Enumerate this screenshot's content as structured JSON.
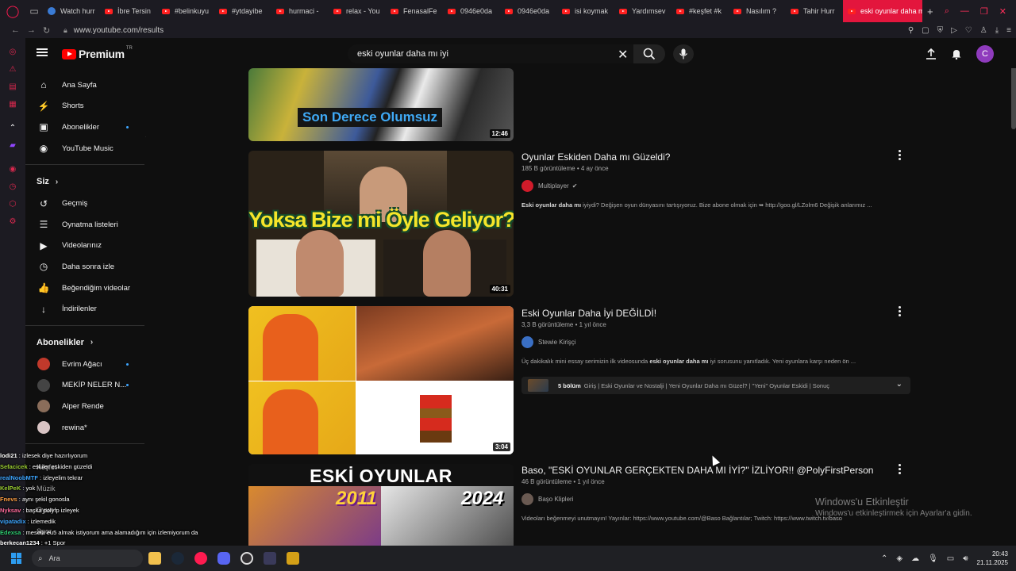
{
  "browser": {
    "tabs": [
      {
        "label": "Watch hurr",
        "kind": "blue"
      },
      {
        "label": "İbre Tersin",
        "kind": "yt"
      },
      {
        "label": "#belinkuyu",
        "kind": "yt"
      },
      {
        "label": "#ytdayibe",
        "kind": "yt"
      },
      {
        "label": "hurmaci -",
        "kind": "yt"
      },
      {
        "label": "relax - You",
        "kind": "yt"
      },
      {
        "label": "FenasalFe",
        "kind": "yt"
      },
      {
        "label": "0946e0da",
        "kind": "yt"
      },
      {
        "label": "0946e0da",
        "kind": "yt"
      },
      {
        "label": "isi koymak",
        "kind": "yt"
      },
      {
        "label": "Yardımsev",
        "kind": "yt"
      },
      {
        "label": "#keşfet #k",
        "kind": "yt"
      },
      {
        "label": "Nasılım ?",
        "kind": "yt"
      },
      {
        "label": "Tahir Hurr",
        "kind": "yt"
      }
    ],
    "active_tab": "eski oyunlar daha mı",
    "url": "www.youtube.com/results"
  },
  "masthead": {
    "logo": "Premium",
    "logo_country": "TR",
    "search_value": "eski oyunlar daha mı iyi",
    "avatar_letter": "C"
  },
  "guide": {
    "main": [
      {
        "label": "Ana Sayfa",
        "icon": "home-icon",
        "glyph": "⌂"
      },
      {
        "label": "Shorts",
        "icon": "shorts-icon",
        "glyph": "⚡"
      },
      {
        "label": "Abonelikler",
        "icon": "subscriptions-icon",
        "glyph": "▣",
        "dot": true
      },
      {
        "label": "YouTube Music",
        "icon": "music-icon",
        "glyph": "◉"
      }
    ],
    "you_heading": "Siz",
    "you": [
      {
        "label": "Geçmiş",
        "icon": "history-icon",
        "glyph": "↺"
      },
      {
        "label": "Oynatma listeleri",
        "icon": "playlists-icon",
        "glyph": "☰"
      },
      {
        "label": "Videolarınız",
        "icon": "your-videos-icon",
        "glyph": "▶"
      },
      {
        "label": "Daha sonra izle",
        "icon": "watch-later-icon",
        "glyph": "◷"
      },
      {
        "label": "Beğendiğim videolar",
        "icon": "liked-icon",
        "glyph": "👍"
      },
      {
        "label": "İndirilenler",
        "icon": "downloads-icon",
        "glyph": "↓"
      }
    ],
    "subs_heading": "Abonelikler",
    "subs": [
      {
        "label": "Evrim Ağacı",
        "color": "#c0392b",
        "dot": true
      },
      {
        "label": "MEKİP NELER N...",
        "color": "#444444",
        "dot": true
      },
      {
        "label": "Alper Rende",
        "color": "#8a6d5a",
        "dot": false
      },
      {
        "label": "rewina*",
        "color": "#d9c4c4",
        "dot": false
      }
    ]
  },
  "results": [
    {
      "duration": "12:46",
      "thumb_text": "Son Derece Olumsuz"
    },
    {
      "title": "Oyunlar Eskiden Daha mı Güzeldi?",
      "views": "185 B görüntüleme",
      "age": "4 ay önce",
      "channel": "Multiplayer",
      "verified": true,
      "desc_pre": "",
      "desc_bold": "Eski oyunlar daha mı",
      "desc_post": " iyiydi? Değişen oyun dünyasını tartışıyoruz. Bize abone olmak için ➥ http://goo.gl/LZolm6 Değişik anlarımız ...",
      "duration": "40:31",
      "thumb_text": "Yoksa Bize mi Öyle Geliyor?"
    },
    {
      "title": "Eski Oyunlar Daha İyi DEĞİLDİ!",
      "views": "3,3 B görüntüleme",
      "age": "1 yıl önce",
      "channel": "Stewie Kirişçi",
      "verified": false,
      "desc_pre": "Üç dakikalık mini essay serimizin ilk videosunda ",
      "desc_bold": "eski oyunlar daha mı",
      "desc_post": " iyi sorusunu yanıtladık. Yeni oyunlara karşı neden ön ...",
      "chapters_count": "5 bölüm",
      "chapters_text": "Giriş | Eski Oyunlar ve Nostalji | Yeni Oyunlar Daha mı Güzel? | \"Yeni\" Oyunlar Eskidi | Sonuç",
      "duration": "3:04"
    },
    {
      "title": "Baso, \"ESKİ OYUNLAR GERÇEKTEN DAHA MI İYİ?\" İZLİYOR!! @PolyFirstPerson",
      "views": "46 B görüntüleme",
      "age": "1 yıl önce",
      "channel": "Başo Klipleri",
      "verified": false,
      "desc_pre": "Videoları beğenmeyi unutmayın! Yayınlar: https://www.youtube.com/@Baso Bağlantılar; Twitch: https://www.twitch.tv/baso",
      "desc_bold": "",
      "desc_post": "",
      "thumb_title": "ESKİ OYUNLAR",
      "thumb_y1": "2011",
      "thumb_y2": "2024"
    }
  ],
  "activation": {
    "line1": "Windows'u Etkinleştir",
    "line2": "Windows'u etkinleştirmek için Ayarlar'a gidin."
  },
  "chat": [
    {
      "user": "lodi21",
      "color": "#ffffff",
      "msg": "izlesek diye hazırlıyorum"
    },
    {
      "user": "Sefacicek",
      "color": "#9acd32",
      "msg": "eskiler eskiden güzeldi"
    },
    {
      "user": "realNoobMTF",
      "color": "#3ea6ff",
      "msg": "izleyelim tekrar"
    },
    {
      "user": "KelPeK",
      "color": "#9acd32",
      "msg": "yok"
    },
    {
      "user": "Fnevs",
      "color": "#ff9f43",
      "msg": "aynı şekil gonosla"
    },
    {
      "user": "Nyksav",
      "color": "#ff6b9b",
      "msg": "başka polyfp izleyek"
    },
    {
      "user": "vipatadix",
      "color": "#3ea6ff",
      "msg": "izlemedik"
    },
    {
      "user": "Edexsa",
      "color": "#2ecc71",
      "msg": "mesela eu5 almak istiyorum ama alamadığım için izlemiyorum da"
    },
    {
      "user": "berkecan1234",
      "color": "#ffffff",
      "msg": "+1 Spor"
    },
    {
      "user": "baxxgoeee",
      "color": "#9acd32",
      "msg": "benden diye biliyorum"
    }
  ],
  "overlay_guide": [
    "Keşfet",
    "Müzik",
    "Oyun",
    "Spor"
  ],
  "taskbar": {
    "search_placeholder": "Ara",
    "time": "20:43",
    "date": "21.11.2025"
  }
}
